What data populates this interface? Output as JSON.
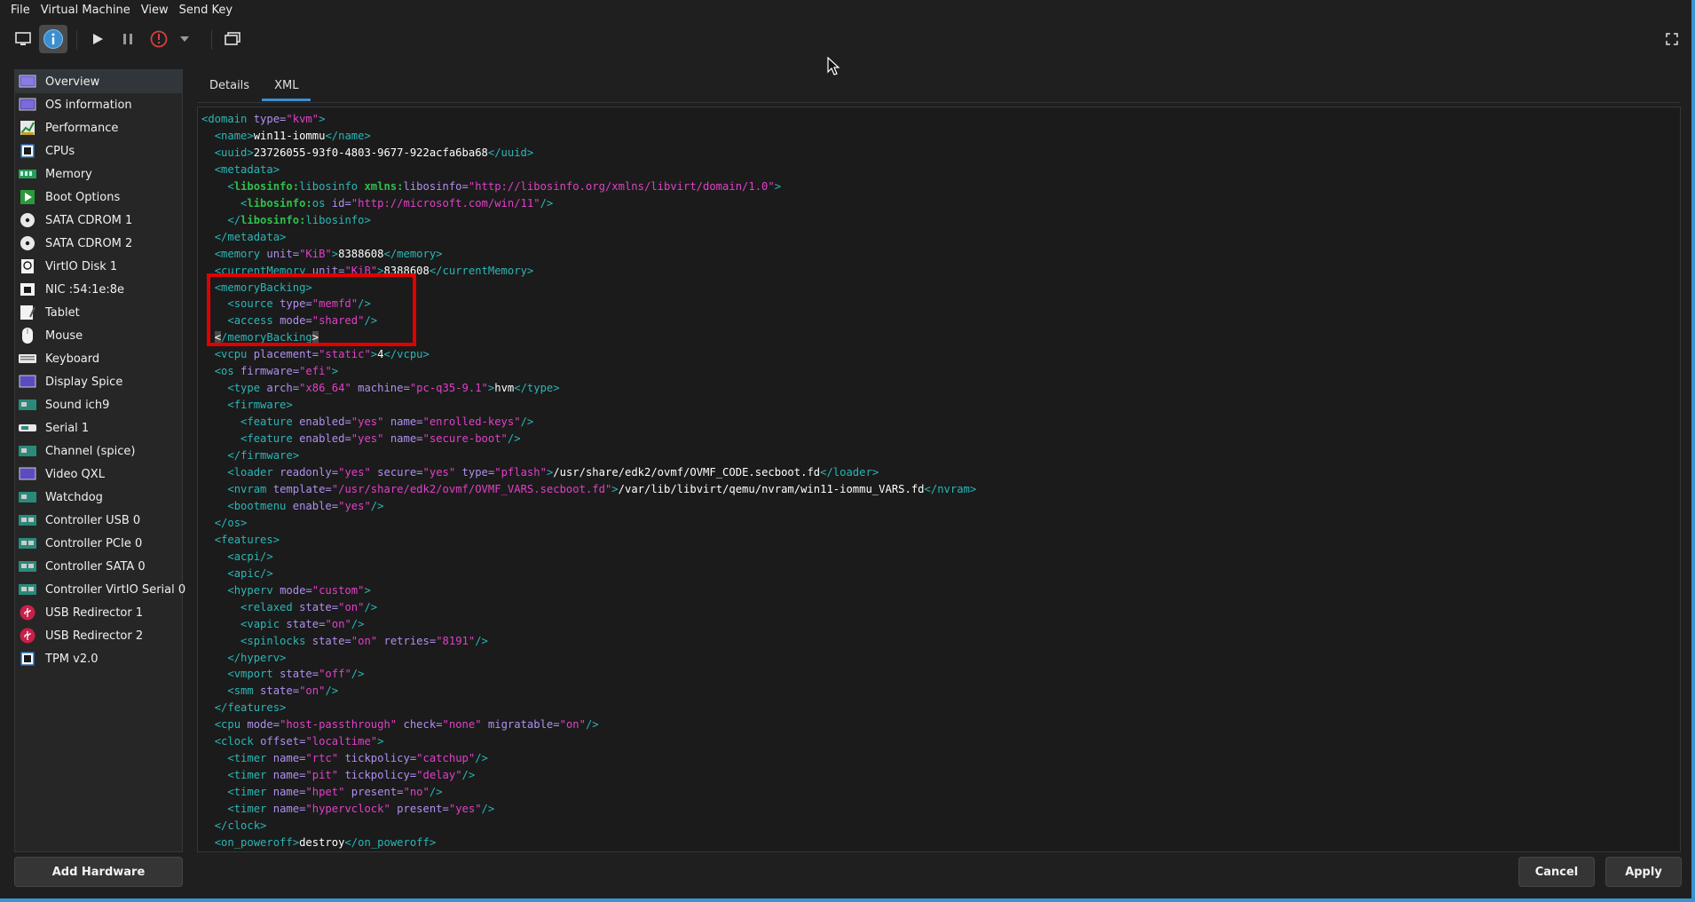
{
  "menubar": {
    "items": [
      "File",
      "Virtual Machine",
      "View",
      "Send Key"
    ]
  },
  "toolbar": {
    "buttons": [
      {
        "name": "console-view-button",
        "icon": "monitor-icon"
      },
      {
        "name": "details-view-button",
        "icon": "info-icon",
        "active": true
      },
      {
        "name": "run-button",
        "icon": "play-icon"
      },
      {
        "name": "pause-button",
        "icon": "pause-icon"
      },
      {
        "name": "shutdown-button",
        "icon": "power-icon"
      },
      {
        "name": "shutdown-menu-button",
        "icon": "chevron-down-icon"
      },
      {
        "name": "snapshots-button",
        "icon": "snapshot-icon"
      },
      {
        "name": "fullscreen-button",
        "icon": "fullscreen-icon"
      }
    ]
  },
  "sidebar": {
    "items": [
      {
        "label": "Overview",
        "icon": "overview-icon",
        "selected": true
      },
      {
        "label": "OS information",
        "icon": "os-info-icon"
      },
      {
        "label": "Performance",
        "icon": "performance-icon"
      },
      {
        "label": "CPUs",
        "icon": "cpu-icon"
      },
      {
        "label": "Memory",
        "icon": "memory-icon"
      },
      {
        "label": "Boot Options",
        "icon": "boot-icon"
      },
      {
        "label": "SATA CDROM 1",
        "icon": "cdrom-icon"
      },
      {
        "label": "SATA CDROM 2",
        "icon": "cdrom-icon"
      },
      {
        "label": "VirtIO Disk 1",
        "icon": "disk-icon"
      },
      {
        "label": "NIC :54:1e:8e",
        "icon": "nic-icon"
      },
      {
        "label": "Tablet",
        "icon": "tablet-icon"
      },
      {
        "label": "Mouse",
        "icon": "mouse-icon"
      },
      {
        "label": "Keyboard",
        "icon": "keyboard-icon"
      },
      {
        "label": "Display Spice",
        "icon": "display-icon"
      },
      {
        "label": "Sound ich9",
        "icon": "sound-icon"
      },
      {
        "label": "Serial 1",
        "icon": "serial-icon"
      },
      {
        "label": "Channel (spice)",
        "icon": "channel-icon"
      },
      {
        "label": "Video QXL",
        "icon": "video-icon"
      },
      {
        "label": "Watchdog",
        "icon": "watchdog-icon"
      },
      {
        "label": "Controller USB 0",
        "icon": "controller-icon"
      },
      {
        "label": "Controller PCIe 0",
        "icon": "controller-icon"
      },
      {
        "label": "Controller SATA 0",
        "icon": "controller-icon"
      },
      {
        "label": "Controller VirtIO Serial 0",
        "icon": "controller-icon"
      },
      {
        "label": "USB Redirector 1",
        "icon": "usb-icon"
      },
      {
        "label": "USB Redirector 2",
        "icon": "usb-icon"
      },
      {
        "label": "TPM v2.0",
        "icon": "tpm-icon"
      }
    ],
    "add_hardware": "Add Hardware"
  },
  "tabs": [
    {
      "label": "Details",
      "active": false
    },
    {
      "label": "XML",
      "active": true
    }
  ],
  "xml_lines": [
    [
      [
        "t",
        "<domain "
      ],
      [
        "a",
        "type="
      ],
      [
        "v",
        "\"kvm\""
      ],
      [
        "t",
        ">"
      ]
    ],
    [
      [
        "p",
        "  "
      ],
      [
        "t",
        "<name>"
      ],
      [
        "x",
        "win11-iommu"
      ],
      [
        "t",
        "</name>"
      ]
    ],
    [
      [
        "p",
        "  "
      ],
      [
        "t",
        "<uuid>"
      ],
      [
        "x",
        "23726055-93f0-4803-9677-922acfa6ba68"
      ],
      [
        "t",
        "</uuid>"
      ]
    ],
    [
      [
        "p",
        "  "
      ],
      [
        "t",
        "<metadata>"
      ]
    ],
    [
      [
        "p",
        "    "
      ],
      [
        "t",
        "<"
      ],
      [
        "nsb",
        "libosinfo:"
      ],
      [
        "t",
        "libosinfo "
      ],
      [
        "nsb",
        "xmlns:"
      ],
      [
        "a",
        "libosinfo="
      ],
      [
        "v",
        "\"http://libosinfo.org/xmlns/libvirt/domain/1.0\""
      ],
      [
        "t",
        ">"
      ]
    ],
    [
      [
        "p",
        "      "
      ],
      [
        "t",
        "<"
      ],
      [
        "nsb",
        "libosinfo:"
      ],
      [
        "t",
        "os "
      ],
      [
        "a",
        "id="
      ],
      [
        "v",
        "\"http://microsoft.com/win/11\""
      ],
      [
        "t",
        "/>"
      ]
    ],
    [
      [
        "p",
        "    "
      ],
      [
        "t",
        "</"
      ],
      [
        "nsb",
        "libosinfo:"
      ],
      [
        "t",
        "libosinfo>"
      ]
    ],
    [
      [
        "p",
        "  "
      ],
      [
        "t",
        "</metadata>"
      ]
    ],
    [
      [
        "p",
        "  "
      ],
      [
        "t",
        "<memory "
      ],
      [
        "a",
        "unit="
      ],
      [
        "v",
        "\"KiB\""
      ],
      [
        "t",
        ">"
      ],
      [
        "x",
        "8388608"
      ],
      [
        "t",
        "</memory>"
      ]
    ],
    [
      [
        "p",
        "  "
      ],
      [
        "t",
        "<currentMemory "
      ],
      [
        "a",
        "unit="
      ],
      [
        "v",
        "\"KiB\""
      ],
      [
        "t",
        ">"
      ],
      [
        "x",
        "8388608"
      ],
      [
        "t",
        "</currentMemory>"
      ]
    ],
    [
      [
        "p",
        "  "
      ],
      [
        "t",
        "<memoryBacking>"
      ]
    ],
    [
      [
        "p",
        "    "
      ],
      [
        "t",
        "<source "
      ],
      [
        "a",
        "type="
      ],
      [
        "v",
        "\"memfd\""
      ],
      [
        "t",
        "/>"
      ]
    ],
    [
      [
        "p",
        "    "
      ],
      [
        "t",
        "<access "
      ],
      [
        "a",
        "mode="
      ],
      [
        "v",
        "\"shared\""
      ],
      [
        "t",
        "/>"
      ]
    ],
    [
      [
        "p",
        "  "
      ],
      [
        "sel",
        "<"
      ],
      [
        "t",
        "/memoryBacking"
      ],
      [
        "sel",
        ">"
      ]
    ],
    [
      [
        "p",
        "  "
      ],
      [
        "t",
        "<vcpu "
      ],
      [
        "a",
        "placement="
      ],
      [
        "v",
        "\"static\""
      ],
      [
        "t",
        ">"
      ],
      [
        "x",
        "4"
      ],
      [
        "t",
        "</vcpu>"
      ]
    ],
    [
      [
        "p",
        "  "
      ],
      [
        "t",
        "<os "
      ],
      [
        "a",
        "firmware="
      ],
      [
        "v",
        "\"efi\""
      ],
      [
        "t",
        ">"
      ]
    ],
    [
      [
        "p",
        "    "
      ],
      [
        "t",
        "<type "
      ],
      [
        "a",
        "arch="
      ],
      [
        "v",
        "\"x86_64\""
      ],
      [
        "t",
        " "
      ],
      [
        "a",
        "machine="
      ],
      [
        "v",
        "\"pc-q35-9.1\""
      ],
      [
        "t",
        ">"
      ],
      [
        "x",
        "hvm"
      ],
      [
        "t",
        "</type>"
      ]
    ],
    [
      [
        "p",
        "    "
      ],
      [
        "t",
        "<firmware>"
      ]
    ],
    [
      [
        "p",
        "      "
      ],
      [
        "t",
        "<feature "
      ],
      [
        "a",
        "enabled="
      ],
      [
        "v",
        "\"yes\""
      ],
      [
        "t",
        " "
      ],
      [
        "a",
        "name="
      ],
      [
        "v",
        "\"enrolled-keys\""
      ],
      [
        "t",
        "/>"
      ]
    ],
    [
      [
        "p",
        "      "
      ],
      [
        "t",
        "<feature "
      ],
      [
        "a",
        "enabled="
      ],
      [
        "v",
        "\"yes\""
      ],
      [
        "t",
        " "
      ],
      [
        "a",
        "name="
      ],
      [
        "v",
        "\"secure-boot\""
      ],
      [
        "t",
        "/>"
      ]
    ],
    [
      [
        "p",
        "    "
      ],
      [
        "t",
        "</firmware>"
      ]
    ],
    [
      [
        "p",
        "    "
      ],
      [
        "t",
        "<loader "
      ],
      [
        "a",
        "readonly="
      ],
      [
        "v",
        "\"yes\""
      ],
      [
        "t",
        " "
      ],
      [
        "a",
        "secure="
      ],
      [
        "v",
        "\"yes\""
      ],
      [
        "t",
        " "
      ],
      [
        "a",
        "type="
      ],
      [
        "v",
        "\"pflash\""
      ],
      [
        "t",
        ">"
      ],
      [
        "x",
        "/usr/share/edk2/ovmf/OVMF_CODE.secboot.fd"
      ],
      [
        "t",
        "</loader>"
      ]
    ],
    [
      [
        "p",
        "    "
      ],
      [
        "t",
        "<nvram "
      ],
      [
        "a",
        "template="
      ],
      [
        "v",
        "\"/usr/share/edk2/ovmf/OVMF_VARS.secboot.fd\""
      ],
      [
        "t",
        ">"
      ],
      [
        "x",
        "/var/lib/libvirt/qemu/nvram/win11-iommu_VARS.fd"
      ],
      [
        "t",
        "</nvram>"
      ]
    ],
    [
      [
        "p",
        "    "
      ],
      [
        "t",
        "<bootmenu "
      ],
      [
        "a",
        "enable="
      ],
      [
        "v",
        "\"yes\""
      ],
      [
        "t",
        "/>"
      ]
    ],
    [
      [
        "p",
        "  "
      ],
      [
        "t",
        "</os>"
      ]
    ],
    [
      [
        "p",
        "  "
      ],
      [
        "t",
        "<features>"
      ]
    ],
    [
      [
        "p",
        "    "
      ],
      [
        "t",
        "<acpi/>"
      ]
    ],
    [
      [
        "p",
        "    "
      ],
      [
        "t",
        "<apic/>"
      ]
    ],
    [
      [
        "p",
        "    "
      ],
      [
        "t",
        "<hyperv "
      ],
      [
        "a",
        "mode="
      ],
      [
        "v",
        "\"custom\""
      ],
      [
        "t",
        ">"
      ]
    ],
    [
      [
        "p",
        "      "
      ],
      [
        "t",
        "<relaxed "
      ],
      [
        "a",
        "state="
      ],
      [
        "v",
        "\"on\""
      ],
      [
        "t",
        "/>"
      ]
    ],
    [
      [
        "p",
        "      "
      ],
      [
        "t",
        "<vapic "
      ],
      [
        "a",
        "state="
      ],
      [
        "v",
        "\"on\""
      ],
      [
        "t",
        "/>"
      ]
    ],
    [
      [
        "p",
        "      "
      ],
      [
        "t",
        "<spinlocks "
      ],
      [
        "a",
        "state="
      ],
      [
        "v",
        "\"on\""
      ],
      [
        "t",
        " "
      ],
      [
        "a",
        "retries="
      ],
      [
        "v",
        "\"8191\""
      ],
      [
        "t",
        "/>"
      ]
    ],
    [
      [
        "p",
        "    "
      ],
      [
        "t",
        "</hyperv>"
      ]
    ],
    [
      [
        "p",
        "    "
      ],
      [
        "t",
        "<vmport "
      ],
      [
        "a",
        "state="
      ],
      [
        "v",
        "\"off\""
      ],
      [
        "t",
        "/>"
      ]
    ],
    [
      [
        "p",
        "    "
      ],
      [
        "t",
        "<smm "
      ],
      [
        "a",
        "state="
      ],
      [
        "v",
        "\"on\""
      ],
      [
        "t",
        "/>"
      ]
    ],
    [
      [
        "p",
        "  "
      ],
      [
        "t",
        "</features>"
      ]
    ],
    [
      [
        "p",
        "  "
      ],
      [
        "t",
        "<cpu "
      ],
      [
        "a",
        "mode="
      ],
      [
        "v",
        "\"host-passthrough\""
      ],
      [
        "t",
        " "
      ],
      [
        "a",
        "check="
      ],
      [
        "v",
        "\"none\""
      ],
      [
        "t",
        " "
      ],
      [
        "a",
        "migratable="
      ],
      [
        "v",
        "\"on\""
      ],
      [
        "t",
        "/>"
      ]
    ],
    [
      [
        "p",
        "  "
      ],
      [
        "t",
        "<clock "
      ],
      [
        "a",
        "offset="
      ],
      [
        "v",
        "\"localtime\""
      ],
      [
        "t",
        ">"
      ]
    ],
    [
      [
        "p",
        "    "
      ],
      [
        "t",
        "<timer "
      ],
      [
        "a",
        "name="
      ],
      [
        "v",
        "\"rtc\""
      ],
      [
        "t",
        " "
      ],
      [
        "a",
        "tickpolicy="
      ],
      [
        "v",
        "\"catchup\""
      ],
      [
        "t",
        "/>"
      ]
    ],
    [
      [
        "p",
        "    "
      ],
      [
        "t",
        "<timer "
      ],
      [
        "a",
        "name="
      ],
      [
        "v",
        "\"pit\""
      ],
      [
        "t",
        " "
      ],
      [
        "a",
        "tickpolicy="
      ],
      [
        "v",
        "\"delay\""
      ],
      [
        "t",
        "/>"
      ]
    ],
    [
      [
        "p",
        "    "
      ],
      [
        "t",
        "<timer "
      ],
      [
        "a",
        "name="
      ],
      [
        "v",
        "\"hpet\""
      ],
      [
        "t",
        " "
      ],
      [
        "a",
        "present="
      ],
      [
        "v",
        "\"no\""
      ],
      [
        "t",
        "/>"
      ]
    ],
    [
      [
        "p",
        "    "
      ],
      [
        "t",
        "<timer "
      ],
      [
        "a",
        "name="
      ],
      [
        "v",
        "\"hypervclock\""
      ],
      [
        "t",
        " "
      ],
      [
        "a",
        "present="
      ],
      [
        "v",
        "\"yes\""
      ],
      [
        "t",
        "/>"
      ]
    ],
    [
      [
        "p",
        "  "
      ],
      [
        "t",
        "</clock>"
      ]
    ],
    [
      [
        "p",
        "  "
      ],
      [
        "t",
        "<on_poweroff>"
      ],
      [
        "x",
        "destroy"
      ],
      [
        "t",
        "</on_poweroff>"
      ]
    ]
  ],
  "footer": {
    "cancel_label": "Cancel",
    "apply_label": "Apply"
  },
  "colors": {
    "tag": "#2bb6b6",
    "attribute": "#b08ff0",
    "value": "#e040c8",
    "namespace": "#2fc04a",
    "accent": "#3b8ed0",
    "highlight_box": "#e00000"
  }
}
